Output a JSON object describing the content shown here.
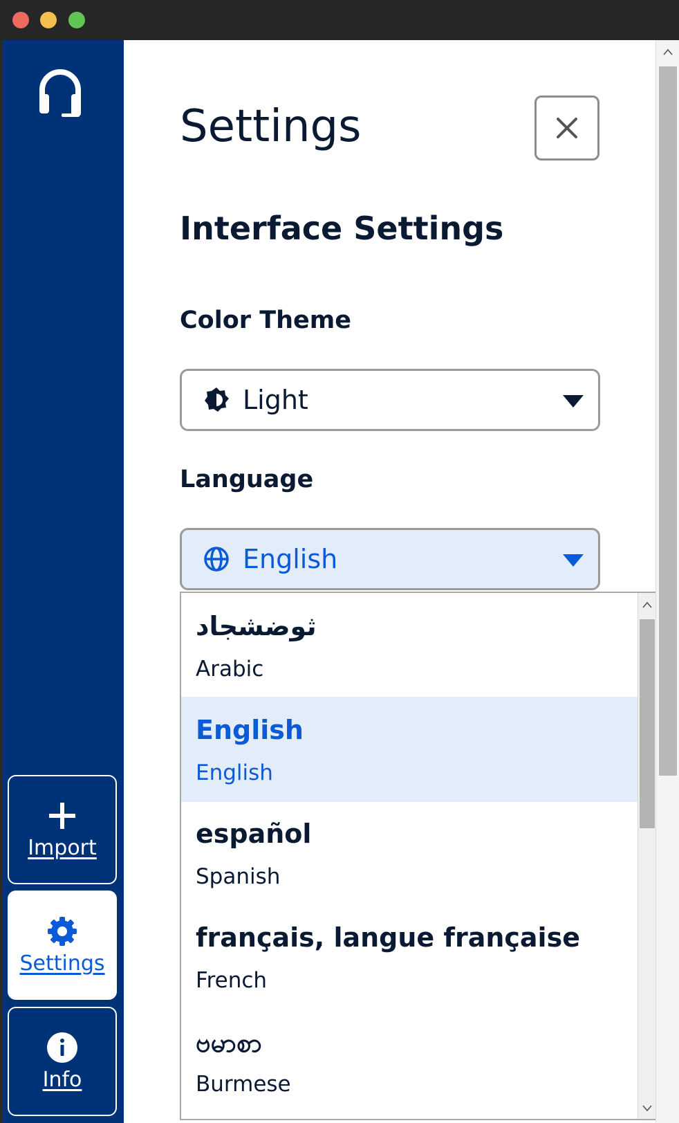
{
  "sidebar": {
    "logo_icon": "headset-icon",
    "nav": [
      {
        "label": "Import",
        "icon": "plus-icon"
      },
      {
        "label": "Settings",
        "icon": "gear-icon"
      },
      {
        "label": "Info",
        "icon": "info-icon"
      }
    ],
    "active": "Settings"
  },
  "settings": {
    "title": "Settings",
    "close_icon": "close-icon",
    "section_heading": "Interface Settings",
    "color_theme": {
      "label": "Color Theme",
      "value": "Light",
      "icon": "brightness-icon"
    },
    "language": {
      "label": "Language",
      "value": "English",
      "icon": "globe-icon",
      "expanded": true,
      "options": [
        {
          "native": "ثوضشجاد",
          "english": "Arabic"
        },
        {
          "native": "English",
          "english": "English",
          "selected": true
        },
        {
          "native": "español",
          "english": "Spanish"
        },
        {
          "native": "français, langue française",
          "english": "French"
        },
        {
          "native": "ဗမာစာ",
          "english": "Burmese"
        }
      ]
    }
  },
  "colors": {
    "sidebar_bg": "#003278",
    "accent": "#0b5ad8",
    "selected_bg": "#e3edfa",
    "text": "#0b1a33"
  }
}
